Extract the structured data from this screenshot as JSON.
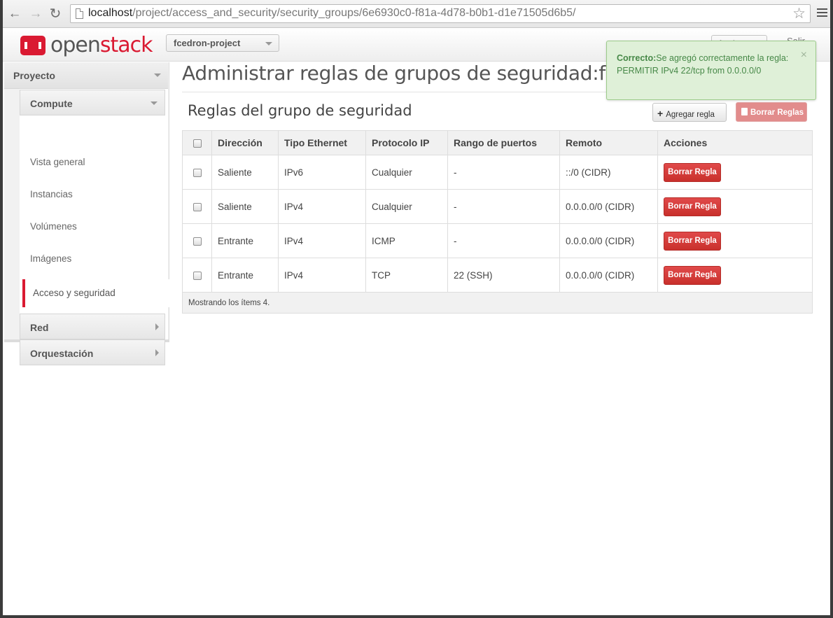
{
  "browser": {
    "url_host": "localhost",
    "url_path": "/project/access_and_security/security_groups/6e6930c0-f81a-4d78-b0b1-d1e71505d6b5/"
  },
  "header": {
    "logo_part1": "open",
    "logo_part2": "stack",
    "project": "fcedron-project",
    "user": "fcedron",
    "signout": "Salir"
  },
  "sidebar": {
    "panel": "Proyecto",
    "group": "Compute",
    "links": [
      "Vista general",
      "Instancias",
      "Volúmenes",
      "Imágenes",
      "Acceso y seguridad"
    ],
    "sections": [
      "Red",
      "Orquestación"
    ]
  },
  "main": {
    "page_title": "Administrar reglas de grupos de seguridad:fcedron",
    "section_title": "Reglas del grupo de seguridad",
    "add_button": "Agregar regla",
    "delete_all_button": "Borrar Reglas"
  },
  "table": {
    "columns": [
      "Dirección",
      "Tipo Ethernet",
      "Protocolo IP",
      "Rango de puertos",
      "Remoto",
      "Acciones"
    ],
    "rows": [
      {
        "direction": "Saliente",
        "ethertype": "IPv6",
        "protocol": "Cualquier",
        "port_range": "-",
        "remote": "::/0 (CIDR)",
        "action": "Borrar Regla"
      },
      {
        "direction": "Saliente",
        "ethertype": "IPv4",
        "protocol": "Cualquier",
        "port_range": "-",
        "remote": "0.0.0.0/0 (CIDR)",
        "action": "Borrar Regla"
      },
      {
        "direction": "Entrante",
        "ethertype": "IPv4",
        "protocol": "ICMP",
        "port_range": "-",
        "remote": "0.0.0.0/0 (CIDR)",
        "action": "Borrar Regla"
      },
      {
        "direction": "Entrante",
        "ethertype": "IPv4",
        "protocol": "TCP",
        "port_range": "22 (SSH)",
        "remote": "0.0.0.0/0 (CIDR)",
        "action": "Borrar Regla"
      }
    ],
    "footer": "Mostrando los ítems 4."
  },
  "alert": {
    "title": "Correcto:",
    "message": "Se agregó correctamente la regla: PERMITIR IPv4 22/tcp from 0.0.0.0/0",
    "close": "×"
  },
  "colors": {
    "brand_red": "#da1a32",
    "alert_bg": "#dff0d8",
    "alert_text": "#468847",
    "danger_button": "#d9534f"
  }
}
